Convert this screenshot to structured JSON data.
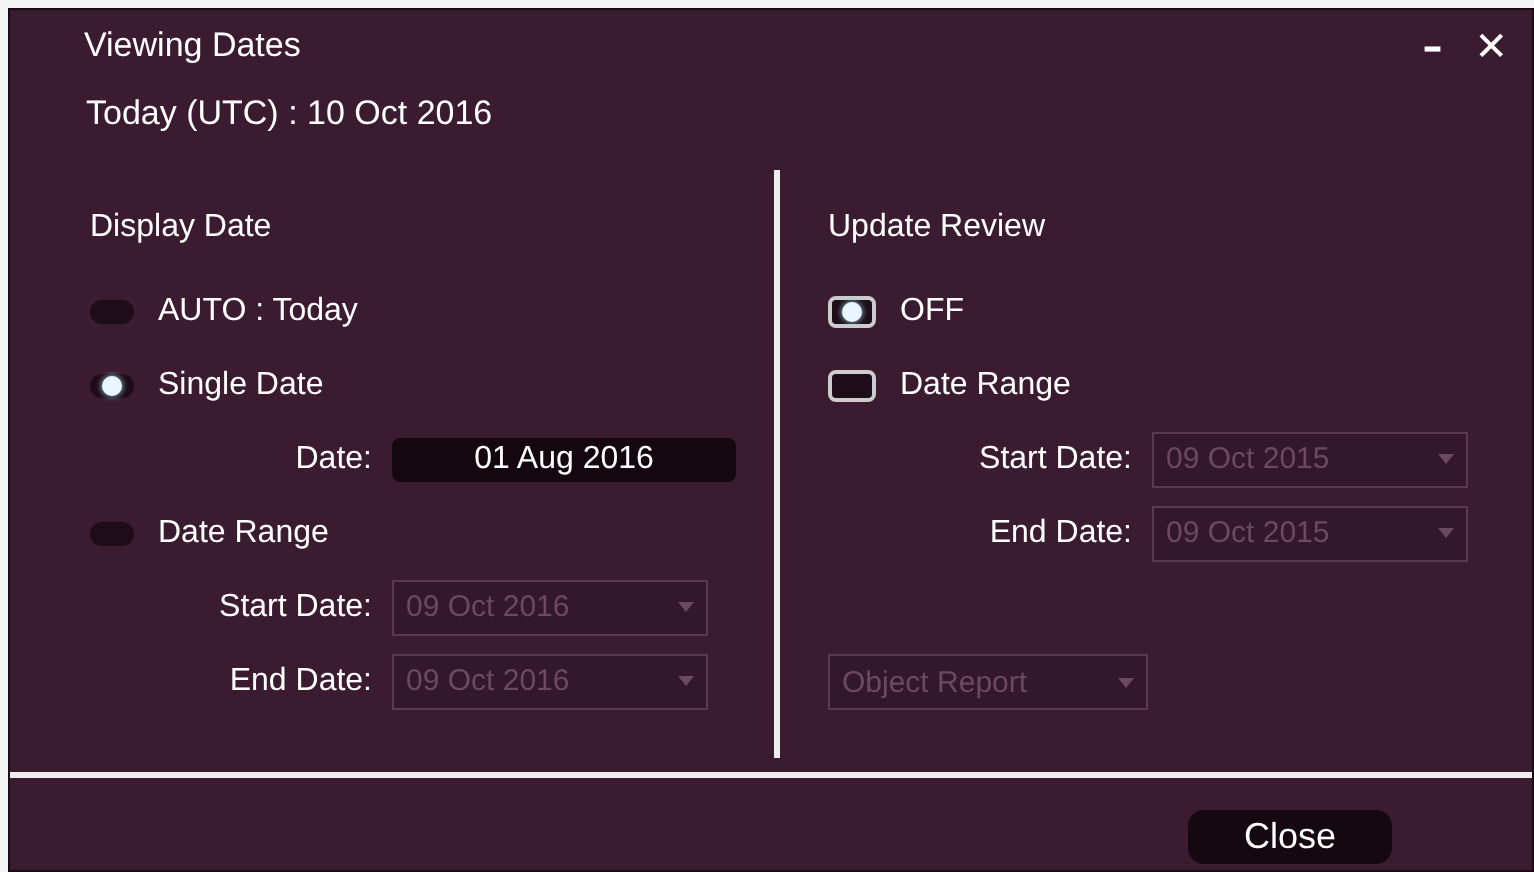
{
  "window": {
    "title": "Viewing Dates",
    "controls": [
      "–",
      "✕"
    ]
  },
  "today": "Today (UTC) : 10 Oct 2016",
  "display_date": {
    "heading": "Display Date",
    "options": [
      {
        "label": "AUTO : Today",
        "selected": false
      },
      {
        "label": "Single Date",
        "selected": true,
        "fields": [
          {
            "kind": "date",
            "label": "Date:",
            "value": "01 Aug 2016",
            "disabled": false
          }
        ]
      },
      {
        "label": "Date Range",
        "selected": false,
        "fields": [
          {
            "kind": "dropdown",
            "label": "Start Date:",
            "value": "09 Oct 2016",
            "disabled": true
          },
          {
            "kind": "dropdown",
            "label": "End Date:",
            "value": "09 Oct 2016",
            "disabled": true
          }
        ]
      }
    ]
  },
  "update_review": {
    "heading": "Update Review",
    "options": [
      {
        "label": "OFF",
        "selected": true
      },
      {
        "label": "Date Range",
        "selected": false,
        "fields": [
          {
            "kind": "dropdown",
            "label": "Start Date:",
            "value": "09 Oct 2015",
            "disabled": true
          },
          {
            "kind": "dropdown",
            "label": "End Date:",
            "value": "09 Oct 2015",
            "disabled": true
          }
        ]
      }
    ],
    "report": {
      "value": "Object Report",
      "disabled": true
    }
  },
  "buttons": [
    "Close"
  ]
}
